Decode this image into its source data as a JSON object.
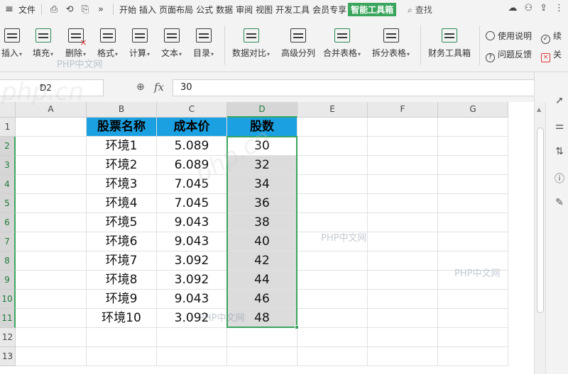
{
  "menubar": {
    "file_label": "文件",
    "tabs": [
      "开始",
      "插入",
      "页面布局",
      "公式",
      "数据",
      "审阅",
      "视图",
      "开发工具",
      "会员专享",
      "智能工具箱"
    ],
    "active_tab": "智能工具箱",
    "search_label": "查找"
  },
  "ribbon": {
    "buttons": [
      "插入",
      "填充",
      "删除",
      "格式",
      "计算",
      "文本",
      "目录",
      "数据对比",
      "高级分列",
      "合并表格",
      "拆分表格",
      "财务工具箱"
    ],
    "help_label": "使用说明",
    "feedback_label": "问题反馈",
    "continue_label": "续",
    "close_label": "关"
  },
  "formula": {
    "cell_ref": "D2",
    "fx": "fx",
    "value": "30"
  },
  "sheet": {
    "columns": [
      "A",
      "B",
      "C",
      "D",
      "E",
      "F",
      "G"
    ],
    "rows": [
      "1",
      "2",
      "3",
      "4",
      "5",
      "6",
      "7",
      "8",
      "9",
      "10",
      "11",
      "12",
      "13"
    ],
    "headers": {
      "name": "股票名称",
      "cost": "成本价",
      "shares": "股数"
    },
    "data": [
      {
        "name": "环境1",
        "cost": "5.089",
        "shares": "30"
      },
      {
        "name": "环境2",
        "cost": "6.089",
        "shares": "32"
      },
      {
        "name": "环境3",
        "cost": "7.045",
        "shares": "34"
      },
      {
        "name": "环境4",
        "cost": "7.045",
        "shares": "36"
      },
      {
        "name": "环境5",
        "cost": "9.043",
        "shares": "38"
      },
      {
        "name": "环境6",
        "cost": "9.043",
        "shares": "40"
      },
      {
        "name": "环境7",
        "cost": "3.092",
        "shares": "42"
      },
      {
        "name": "环境8",
        "cost": "3.092",
        "shares": "44"
      },
      {
        "name": "环境9",
        "cost": "9.043",
        "shares": "46"
      },
      {
        "name": "环境10",
        "cost": "3.092",
        "shares": "48"
      }
    ]
  },
  "watermark": {
    "text": "PHP中文网",
    "domain": "php.cn"
  },
  "colors": {
    "accent": "#3aa55d",
    "header_fill": "#1ba1e2",
    "selection_fill": "#dcdcdc"
  }
}
